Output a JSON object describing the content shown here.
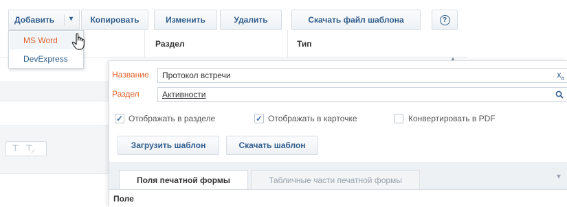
{
  "toolbar": {
    "add_label": "Добавить",
    "add_arrow": "▾",
    "copy_label": "Копировать",
    "edit_label": "Изменить",
    "delete_label": "Удалить",
    "download_template_label": "Скачать файл шаблона",
    "help_icon": "?"
  },
  "dropdown": {
    "items": [
      "MS Word",
      "DevExpress"
    ]
  },
  "grid": {
    "columns": [
      "Раздел",
      "Тип"
    ]
  },
  "card": {
    "name_label": "Название",
    "name_value": "Протокол встречи",
    "section_label": "Раздел",
    "section_value": "Активности",
    "show_in_section_label": "Отображать в разделе",
    "show_in_card_label": "Отображать в карточке",
    "convert_pdf_label": "Конвертировать в PDF",
    "show_in_section_checked": true,
    "show_in_card_checked": true,
    "convert_pdf_checked": false,
    "upload_template_label": "Загрузить шаблон",
    "download_template_label": "Скачать шаблон",
    "tabs": [
      "Поля печатной формы",
      "Табличные части печатной формы"
    ],
    "active_tab": 0,
    "field_column_label": "Поле"
  },
  "colors": {
    "accent_link": "#2f5e8c",
    "field_label": "#e2622c",
    "dropdown_selected_text": "#e2622c",
    "checkbox_check": "#3b6ea5"
  }
}
